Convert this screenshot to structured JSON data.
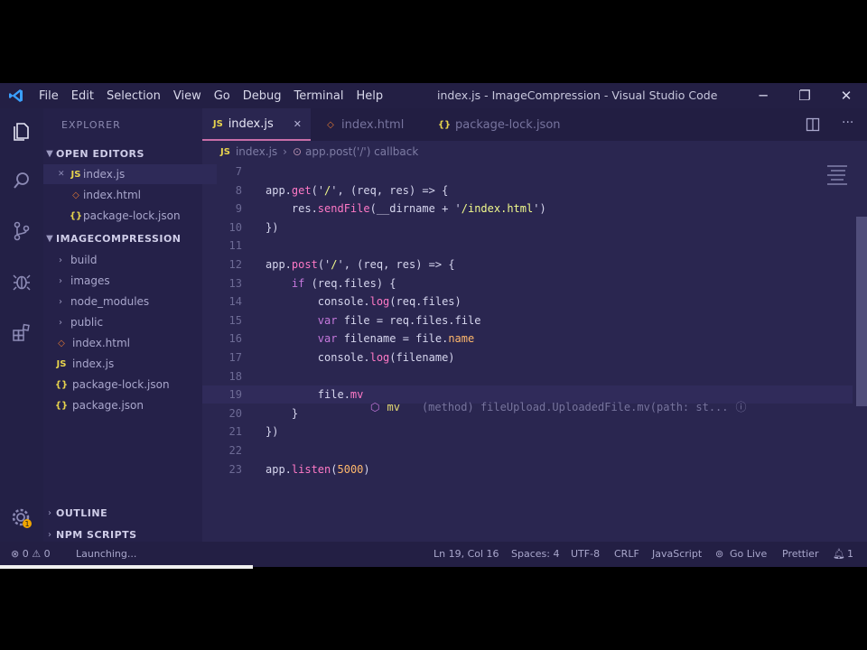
{
  "window": {
    "title": "index.js - ImageCompression - Visual Studio Code",
    "minimize_glyph": "─",
    "maximize_glyph": "❐",
    "close_glyph": "✕"
  },
  "menu": [
    "File",
    "Edit",
    "Selection",
    "View",
    "Go",
    "Debug",
    "Terminal",
    "Help"
  ],
  "sidebar": {
    "title": "EXPLORER",
    "open_editors_label": "OPEN EDITORS",
    "open_editors": [
      {
        "icon": "JS",
        "label": "index.js",
        "close": "✕"
      },
      {
        "icon": "◇",
        "label": "index.html"
      },
      {
        "icon": "{}",
        "label": "package-lock.json"
      }
    ],
    "project_label": "IMAGECOMPRESSION",
    "project_items": [
      {
        "type": "folder",
        "label": "build"
      },
      {
        "type": "folder",
        "label": "images"
      },
      {
        "type": "folder",
        "label": "node_modules"
      },
      {
        "type": "folder",
        "label": "public"
      },
      {
        "type": "file",
        "icon": "◇",
        "label": "index.html"
      },
      {
        "type": "file",
        "icon": "JS",
        "label": "index.js"
      },
      {
        "type": "file",
        "icon": "{}",
        "label": "package-lock.json"
      },
      {
        "type": "file",
        "icon": "{}",
        "label": "package.json"
      }
    ],
    "outline_label": "OUTLINE",
    "npm_label": "NPM SCRIPTS"
  },
  "tabs": [
    {
      "icon": "JS",
      "label": "index.js",
      "close": "✕",
      "active": true
    },
    {
      "icon": "◇",
      "label": "index.html",
      "active": false
    },
    {
      "icon": "{}",
      "label": "package-lock.json",
      "active": false
    }
  ],
  "breadcrumb": [
    "index.js",
    "app.post('/') callback"
  ],
  "code_lines": [
    {
      "num": "7",
      "tokens": []
    },
    {
      "num": "8",
      "tokens": [
        [
          "pl",
          "app."
        ],
        [
          "fn",
          "get"
        ],
        [
          "pl",
          "('"
        ],
        [
          "str",
          "/"
        ],
        [
          "pl",
          "', (req, res) => {"
        ]
      ]
    },
    {
      "num": "9",
      "tokens": [
        [
          "pl",
          "    res."
        ],
        [
          "fn",
          "sendFile"
        ],
        [
          "pl",
          "(__dirname + '"
        ],
        [
          "str",
          "/index.html"
        ],
        [
          "pl",
          "')"
        ]
      ]
    },
    {
      "num": "10",
      "tokens": [
        [
          "pl",
          "})"
        ]
      ]
    },
    {
      "num": "11",
      "tokens": []
    },
    {
      "num": "12",
      "tokens": [
        [
          "pl",
          "app."
        ],
        [
          "fn",
          "post"
        ],
        [
          "pl",
          "('"
        ],
        [
          "str",
          "/"
        ],
        [
          "pl",
          "', (req, res) => {"
        ]
      ]
    },
    {
      "num": "13",
      "tokens": [
        [
          "kw",
          "    if"
        ],
        [
          "pl",
          " (req.files) {"
        ]
      ]
    },
    {
      "num": "14",
      "tokens": [
        [
          "pl",
          "        console."
        ],
        [
          "fn",
          "log"
        ],
        [
          "pl",
          "(req.files)"
        ]
      ]
    },
    {
      "num": "15",
      "tokens": [
        [
          "kw",
          "        var"
        ],
        [
          "pl",
          " file = req.files.file"
        ]
      ]
    },
    {
      "num": "16",
      "tokens": [
        [
          "kw",
          "        var"
        ],
        [
          "pl",
          " filename = file."
        ],
        [
          "var",
          "name"
        ]
      ]
    },
    {
      "num": "17",
      "tokens": [
        [
          "pl",
          "        console."
        ],
        [
          "fn",
          "log"
        ],
        [
          "pl",
          "(filename)"
        ]
      ]
    },
    {
      "num": "18",
      "tokens": []
    },
    {
      "num": "19",
      "tokens": [
        [
          "pl",
          "        file."
        ],
        [
          "fn",
          "mv"
        ]
      ]
    },
    {
      "num": "20",
      "tokens": [
        [
          "pl",
          "    }"
        ]
      ]
    },
    {
      "num": "21",
      "tokens": [
        [
          "pl",
          "})"
        ]
      ]
    },
    {
      "num": "22",
      "tokens": []
    },
    {
      "num": "23",
      "tokens": [
        [
          "pl",
          "app."
        ],
        [
          "fn",
          "listen"
        ],
        [
          "pl",
          "("
        ],
        [
          "var",
          "5000"
        ],
        [
          "pl",
          ")"
        ]
      ]
    }
  ],
  "suggestion": {
    "name": "mv",
    "detail": "(method) fileUpload.UploadedFile.mv(path: st...",
    "info": "ⓘ"
  },
  "statusbar": {
    "problems": "⊗ 0  ⚠ 0",
    "launch": "Launching...",
    "position": "Ln 19, Col 16",
    "spaces": "Spaces: 4",
    "encoding": "UTF-8",
    "eol": "CRLF",
    "language": "JavaScript",
    "golive": "Go Live",
    "prettier": "Prettier",
    "notifications": "1"
  }
}
